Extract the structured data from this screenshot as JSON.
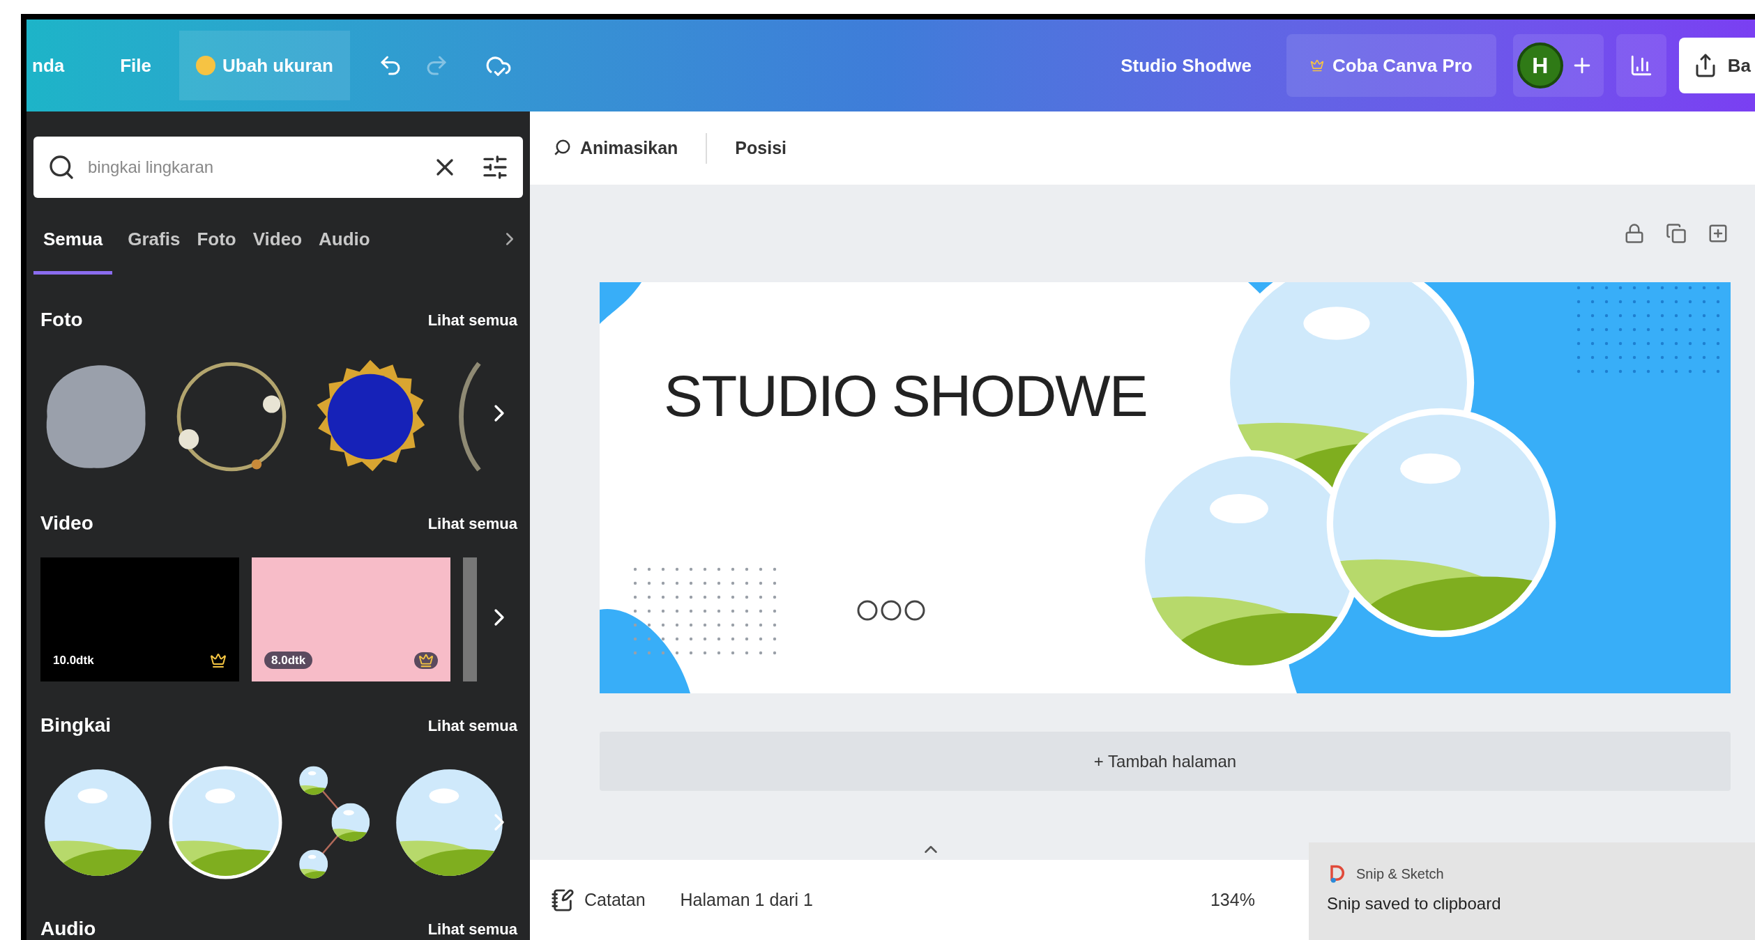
{
  "topbar": {
    "home": "nda",
    "file": "File",
    "resize": "Ubah ukuran",
    "title": "Studio Shodwe",
    "pro": "Coba Canva Pro",
    "avatar": "H",
    "share": "Ba"
  },
  "sidebar": {
    "search": {
      "value": "bingkai lingkaran"
    },
    "tabs": [
      {
        "label": "Semua",
        "selected": true
      },
      {
        "label": "Grafis",
        "selected": false
      },
      {
        "label": "Foto",
        "selected": false
      },
      {
        "label": "Video",
        "selected": false
      },
      {
        "label": "Audio",
        "selected": false
      }
    ],
    "sections": [
      {
        "kind": "photo",
        "title": "Foto",
        "link": "Lihat semua"
      },
      {
        "kind": "video",
        "title": "Video",
        "link": "Lihat semua",
        "items": [
          {
            "duration": "10.0dtk",
            "color": "#000000"
          },
          {
            "duration": "8.0dtk",
            "color": "#f7bcc8"
          }
        ]
      },
      {
        "kind": "frame",
        "title": "Bingkai",
        "link": "Lihat semua"
      },
      {
        "kind": "audio",
        "title": "Audio",
        "link": "Lihat semua"
      }
    ]
  },
  "toolbar": {
    "animate": "Animasikan",
    "position": "Posisi"
  },
  "design": {
    "title": "STUDIO SHODWE"
  },
  "add_page": "+ Tambah halaman",
  "footer": {
    "notes": "Catatan",
    "page": "Halaman 1 dari 1",
    "zoom": "134%"
  },
  "toast": {
    "app": "Snip & Sketch",
    "message": "Snip saved to clipboard"
  }
}
